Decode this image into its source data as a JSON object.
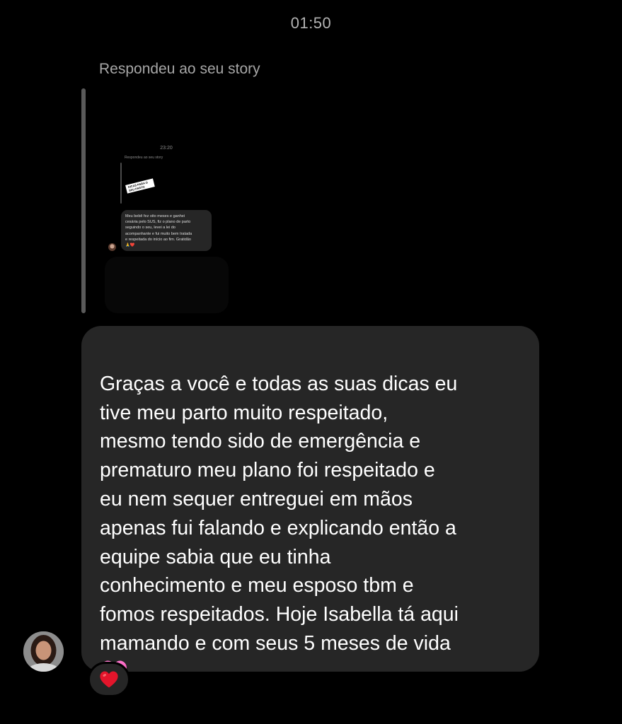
{
  "header": {
    "time": "01:50"
  },
  "reply": {
    "label": "Respondeu ao seu story",
    "story_preview": {
      "time": "23:20",
      "reply_label": "Respondeu ao seu story",
      "sticker_text": "DICAS PARA O SEU PARTO",
      "message": "Meu bebê fez oito meses e ganhei\ncesária pelo SUS, fiz o plano de parto\nseguindo o seu, levei a lei do\nacompanhante e fui muito bem tratada\ne respeitada do início ao fim. Gratidão\n🙏❤️"
    }
  },
  "message": {
    "text": "Graças a você e todas as suas dicas eu\ntive meu parto muito respeitado,\nmesmo tendo sido de emergência e\nprematuro meu plano foi respeitado e\neu nem sequer entreguei em mãos\napenas fui falando e explicando então a\nequipe sabia que eu tinha\nconhecimento e meu esposo tbm e\nfomos respeitados. Hoje Isabella tá aqui\nmamando e com seus 5 meses de vida",
    "emoji": "pink-heart-icon",
    "reaction": "red-heart-icon"
  },
  "colors": {
    "background": "#000000",
    "bubble": "#262626",
    "muted_text": "#a6a6a6",
    "heart_pink": "#ff4fb8",
    "heart_red": "#e3152b"
  }
}
